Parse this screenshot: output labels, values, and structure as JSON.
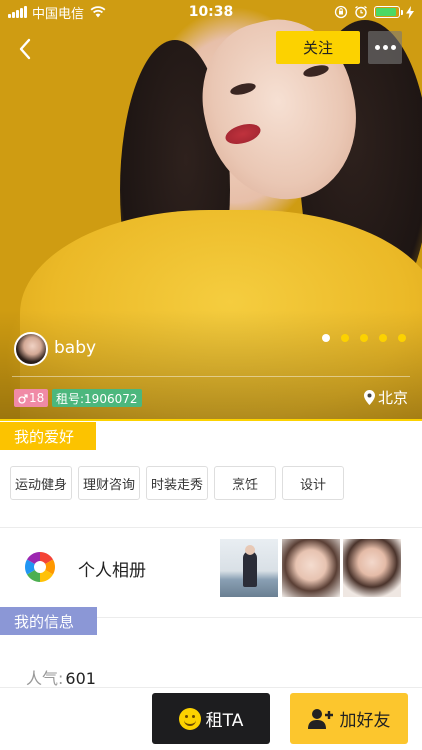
{
  "status_bar": {
    "carrier": "中国电信",
    "time": "10:38",
    "battery_level": 0.9,
    "battery_color": "#4cd964"
  },
  "nav": {
    "follow_label": "关注",
    "back_icon": "chevron-left-icon",
    "more_icon": "more-dots-icon"
  },
  "profile": {
    "username": "baby",
    "age": "18",
    "id_label": "租号:1906072",
    "location": "北京",
    "photo_count": 5,
    "current_photo_index": 0
  },
  "hobbies": {
    "title": "我的爱好",
    "items": [
      "运动健身",
      "理财咨询",
      "时装走秀",
      "烹饪",
      "设计"
    ]
  },
  "album": {
    "label": "个人相册",
    "thumbnail_count": 3
  },
  "info": {
    "title": "我的信息",
    "popularity_label": "人气:",
    "popularity_value": "601"
  },
  "actions": {
    "rent_label": "租TA",
    "add_friend_label": "加好友"
  },
  "colors": {
    "accent_yellow": "#fcd200",
    "hobby_tag": "#fcc300",
    "info_tag": "#8b97d6",
    "gender_badge": "#f08aa6",
    "id_badge": "#4cb77d",
    "rent_button": "#1d1d1f",
    "add_friend_button": "#fcc62d"
  }
}
